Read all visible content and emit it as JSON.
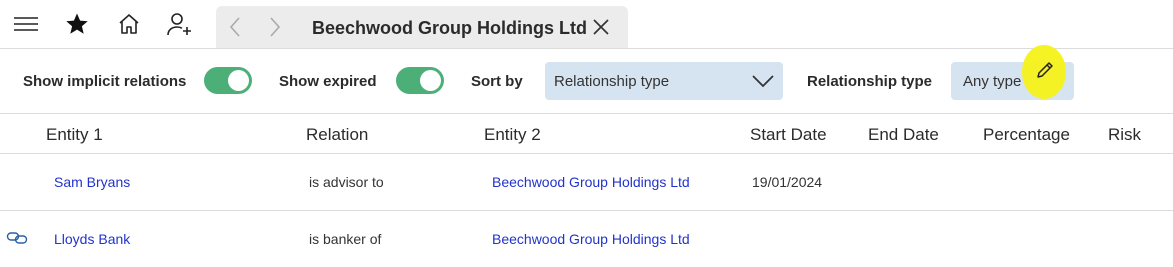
{
  "topbar": {
    "icons": [
      "hamburger-menu-icon",
      "star-icon",
      "home-icon",
      "add-user-icon"
    ],
    "tab": {
      "title": "Beechwood Group Holdings Ltd",
      "back_icon": "chevron-left-icon",
      "forward_icon": "chevron-right-icon",
      "close_icon": "close-icon"
    }
  },
  "filters": {
    "show_implicit_label": "Show implicit relations",
    "show_implicit_on": true,
    "show_expired_label": "Show expired",
    "show_expired_on": true,
    "sort_by_label": "Sort by",
    "sort_by_value": "Relationship type",
    "relationship_type_label": "Relationship type",
    "relationship_type_value": "Any type",
    "edit_icon": "pencil-icon",
    "accent_color": "#4caf78",
    "field_color": "#d6e4f1"
  },
  "table": {
    "columns": [
      "Entity 1",
      "Relation",
      "Entity 2",
      "Start Date",
      "End Date",
      "Percentage",
      "Risk"
    ],
    "rows": [
      {
        "icon": "",
        "entity1": "Sam Bryans",
        "relation": "is advisor to",
        "entity2": "Beechwood Group Holdings Ltd",
        "start": "19/01/2024",
        "end": "",
        "percentage": "",
        "risk": ""
      },
      {
        "icon": "link-icon",
        "entity1": "Lloyds Bank",
        "relation": "is banker of",
        "entity2": "Beechwood Group Holdings Ltd",
        "start": "",
        "end": "",
        "percentage": "",
        "risk": ""
      }
    ],
    "link_color": "#2233cc"
  }
}
